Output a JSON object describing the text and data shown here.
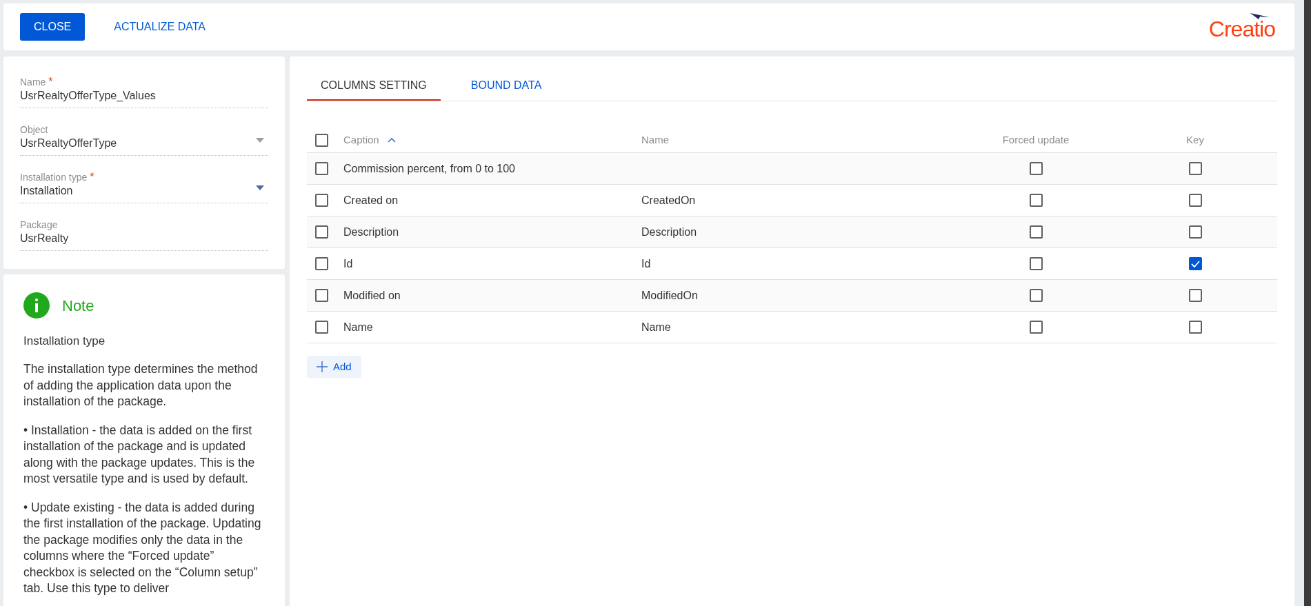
{
  "toolbar": {
    "buttons": [
      {
        "label": "CLOSE",
        "kind": "primary"
      },
      {
        "label": "ACTUALIZE DATA",
        "kind": "link"
      }
    ],
    "logo": "Creatio"
  },
  "fields": [
    {
      "label": "Name",
      "required_mark": "*",
      "value": "UsrRealtyOfferType_Values",
      "kind": "text"
    },
    {
      "label": "Object",
      "value": "UsrRealtyOfferType",
      "kind": "lookup",
      "disabled": true
    },
    {
      "label": "Installation type",
      "required_mark": "*",
      "value": "Installation",
      "kind": "lookup",
      "disabled": false
    },
    {
      "label": "Package",
      "value": "UsrRealty",
      "kind": "text"
    }
  ],
  "note": {
    "title": "Note",
    "subtitle": "Installation type",
    "paragraphs": [
      "The installation type determines the method of adding the application data upon the installation of the package.",
      "• Installation - the data is added on the first installation of the package and is updated along with the package updates. This is the most versatile type and is used by default.",
      "• Update existing - the data is added during the first installation of the package. Updating the package modifies only the data in the columns where the “Forced update” checkbox is selected on the “Column setup” tab. Use this type to deliver"
    ]
  },
  "tabs": [
    {
      "label": "COLUMNS SETTING",
      "selected": true
    },
    {
      "label": "BOUND DATA",
      "selected": false
    }
  ],
  "table": {
    "all_selected": false,
    "columns": [
      "Caption",
      "Name",
      "Forced update",
      "Key"
    ],
    "rows": [
      {
        "selected": false,
        "caption": "Commission percent, from 0 to 100",
        "forced_update": false,
        "key": false
      },
      {
        "selected": false,
        "caption": "Created on",
        "name": "CreatedOn",
        "forced_update": false,
        "key": false
      },
      {
        "selected": false,
        "caption": "Description",
        "name": "Description",
        "forced_update": false,
        "key": false
      },
      {
        "selected": false,
        "caption": "Id",
        "name": "Id",
        "forced_update": false,
        "key": true
      },
      {
        "selected": false,
        "caption": "Modified on",
        "name": "ModifiedOn",
        "forced_update": false,
        "key": false
      },
      {
        "selected": false,
        "caption": "Name",
        "name": "Name",
        "forced_update": false,
        "key": false
      }
    ]
  },
  "add_button": "Add"
}
